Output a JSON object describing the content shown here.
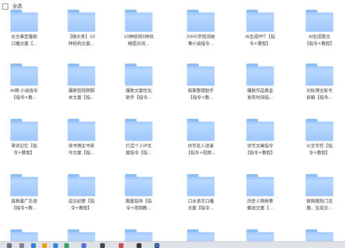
{
  "header": {
    "select_all": "全选"
  },
  "folders": [
    "长文章定爆款\n口播文案【...",
    "【微头条】10\n种结构文案...",
    "10种结构5种风\n格提示词...",
    "5000字民间故\n事小说指令...",
    "AI生成PPT【指\n令+教程】",
    "AI生成歌文\n【指令+教程】",
    "AI周·小说指令\n【指令+教...",
    "爆款短视频脚\n本文案【指...",
    "爆款文案优化\n助手【指令...",
    "探客整理助手\n【指令+教...",
    "爆款作品黄金\n发布时间指...",
    "对标博主账号\n拆解【指令...",
    "单词记忆【指\n令+教程】",
    "读书博主书单\n号文案【指...",
    "打造个人IP文\n案指令【指...",
    "仿写名人语录\n【指令+视频...",
    "仿写文章指令\n【指令+教程】",
    "公文写作【指\n令+教程】",
    "高质量广告语\n【指令+教...",
    "会议纪要【指\n令+教程】",
    "教案指导【指\n令+视频教...",
    "口水语言口播\n文案【指令...",
    "历史人物故事\n解说文案【...",
    "联网搜热门话\n题，生成文..."
  ],
  "colors": {
    "folder": "#a7ceff",
    "folder_tab": "#8bbcf0",
    "taskbar": "#dfe3e8"
  },
  "taskbar_icons": [
    "start-icon",
    "search-icon",
    "edge-icon",
    "chrome-icon",
    "explorer-icon",
    "app-icon",
    "store-icon",
    "wechat-icon",
    "settings-icon",
    "terminal-icon",
    "window-icon"
  ]
}
